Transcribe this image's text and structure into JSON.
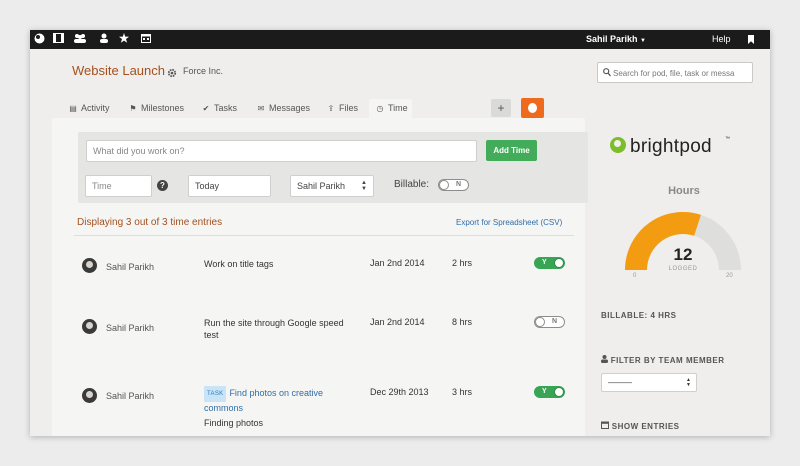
{
  "topbar": {
    "icons": [
      "brightpod-icon",
      "film-icon",
      "users-icon",
      "user-icon",
      "star-icon",
      "calendar-icon"
    ],
    "user_name": "Sahil Parikh",
    "help": "Help"
  },
  "header": {
    "title": "Website Launch",
    "company": "Force Inc.",
    "search_placeholder": "Search for pod, file, task or messa"
  },
  "tabs": [
    {
      "label": "Activity",
      "icon": "activity-icon"
    },
    {
      "label": "Milestones",
      "icon": "flag-icon"
    },
    {
      "label": "Tasks",
      "icon": "check-icon"
    },
    {
      "label": "Messages",
      "icon": "envelope-icon"
    },
    {
      "label": "Files",
      "icon": "upload-icon"
    },
    {
      "label": "Time",
      "icon": "clock-icon",
      "active": true
    }
  ],
  "entry_form": {
    "work_placeholder": "What did you work on?",
    "add_button": "Add Time",
    "time_placeholder": "Time",
    "date_value": "Today",
    "user_value": "Sahil Parikh",
    "billable_label": "Billable:",
    "billable_toggle": "N"
  },
  "list": {
    "summary": "Displaying 3 out of 3 time entries",
    "export_link": "Export for Spreadsheet (CSV)",
    "rows": [
      {
        "name": "Sahil Parikh",
        "description": "Work on title tags",
        "date": "Jan 2nd 2014",
        "hours": "2 hrs",
        "billable": "Y"
      },
      {
        "name": "Sahil Parikh",
        "description": "Run the site through Google speed test",
        "date": "Jan 2nd 2014",
        "hours": "8 hrs",
        "billable": "N"
      },
      {
        "name": "Sahil Parikh",
        "task_badge": "TASK",
        "task_link": "Find photos on creative commons",
        "description": "Finding photos",
        "date": "Dec 29th 2013",
        "hours": "3 hrs",
        "billable": "Y"
      }
    ]
  },
  "sidebar": {
    "logo_text": "brightpod",
    "logo_tm": "™",
    "hours_title": "Hours",
    "hours_logged": "12",
    "logged_label": "LOGGED",
    "gauge_min": "0",
    "gauge_max": "20",
    "gauge_fraction": 0.6,
    "billable_summary": "BILLABLE: 4 HRS",
    "filter_title": "FILTER BY TEAM MEMBER",
    "filter_value": "———",
    "show_entries": "SHOW ENTRIES"
  },
  "colors": {
    "accent_orange": "#ee6b1d",
    "title_brown": "#a4511e",
    "green": "#43ac5a",
    "gauge_fill": "#f39c12",
    "gauge_bg": "#dededc",
    "link_blue": "#2f6ea8"
  }
}
